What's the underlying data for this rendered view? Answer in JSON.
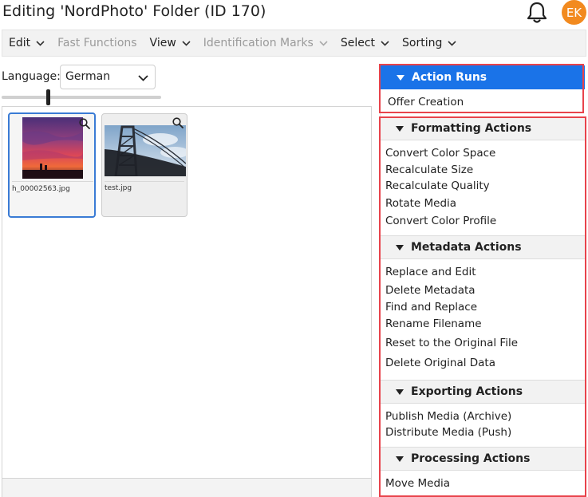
{
  "header": {
    "title": "Editing 'NordPhoto' Folder (ID 170)",
    "avatar_initials": "EK",
    "avatar_color": "#f28a1f",
    "bell_icon": "bell-icon"
  },
  "menubar": {
    "items": [
      {
        "label": "Edit",
        "enabled": true
      },
      {
        "label": "Fast Functions",
        "enabled": false
      },
      {
        "label": "View",
        "enabled": true
      },
      {
        "label": "Identification Marks",
        "enabled": false
      },
      {
        "label": "Select",
        "enabled": true
      },
      {
        "label": "Sorting",
        "enabled": true
      }
    ]
  },
  "language": {
    "label": "Language:",
    "value": "German"
  },
  "thumbnail_size_slider": {
    "value_fraction": 0.29
  },
  "gallery": {
    "items": [
      {
        "filename": "h_00002563.jpg",
        "selected": true
      },
      {
        "filename": "test.jpg",
        "selected": false
      }
    ]
  },
  "actions_panel": {
    "accent_color": "#1a73e8",
    "highlight_color": "#e8434b",
    "action_runs": {
      "title": "Action Runs",
      "items": [
        "Offer Creation"
      ]
    },
    "formatting": {
      "title": "Formatting Actions",
      "items": [
        "Convert Color Space",
        "Recalculate Size",
        "Recalculate Quality",
        "Rotate Media",
        "Convert Color Profile"
      ]
    },
    "metadata": {
      "title": "Metadata Actions",
      "items": [
        "Replace and Edit",
        "Delete Metadata",
        "Find and Replace",
        "Rename Filename",
        "Reset to the Original File",
        "Delete Original Data"
      ]
    },
    "exporting": {
      "title": "Exporting Actions",
      "items": [
        "Publish Media (Archive)",
        "Distribute Media (Push)"
      ]
    },
    "processing": {
      "title": "Processing Actions",
      "items": [
        "Move Media"
      ]
    }
  }
}
